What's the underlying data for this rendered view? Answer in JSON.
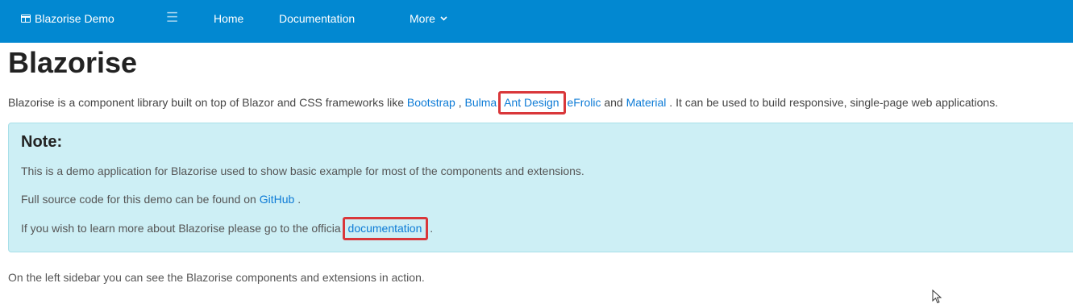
{
  "navbar": {
    "brand": "Blazorise Demo",
    "menu_icon": "hamburger-icon",
    "links": {
      "home": "Home",
      "documentation": "Documentation",
      "more": "More"
    }
  },
  "page": {
    "title": "Blazorise",
    "intro": {
      "prefix": "Blazorise is a component library built on top of Blazor and CSS frameworks like",
      "bootstrap": "Bootstrap",
      "sep1": ",",
      "bulma": "Bulma",
      "ant_design": "Ant Design",
      "efrolic": "eFrolic",
      "and": "and",
      "material": "Material",
      "suffix": ". It can be used to build responsive, single-page web applications."
    },
    "note": {
      "heading": "Note:",
      "line1": "This is a demo application for Blazorise used to show basic example for most of the components and extensions.",
      "line2_prefix": "Full source code for this demo can be found on",
      "line2_link": "GitHub",
      "line2_suffix": ".",
      "line3_prefix": "If you wish to learn more about Blazorise please go to the officia",
      "line3_link": "documentation",
      "line3_suffix": "."
    },
    "footer": "On the left sidebar you can see the Blazorise components and extensions in action."
  },
  "colors": {
    "navbar_bg": "#0288d1",
    "note_bg": "#cdeff5",
    "link": "#0d7bd6",
    "highlight": "#d9373a"
  }
}
